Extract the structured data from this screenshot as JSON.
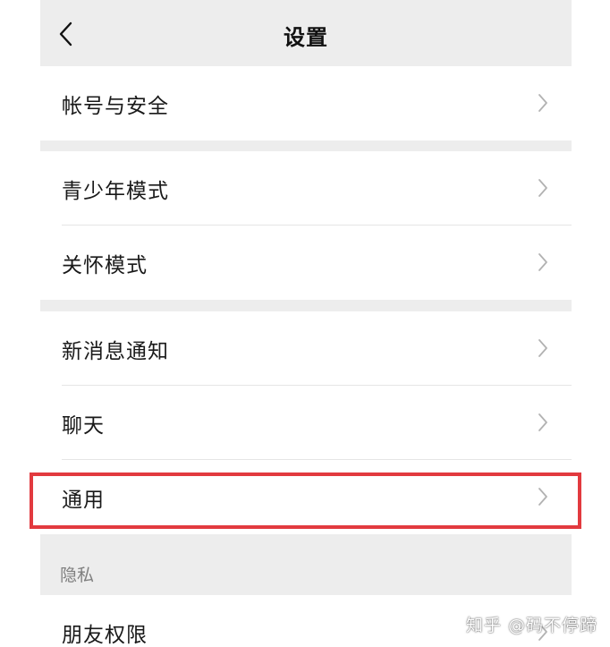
{
  "nav": {
    "title": "设置",
    "back_icon": "chevron-left-icon"
  },
  "groups": [
    {
      "items": [
        {
          "label": "帐号与安全"
        }
      ]
    },
    {
      "items": [
        {
          "label": "青少年模式"
        },
        {
          "label": "关怀模式"
        }
      ]
    },
    {
      "items": [
        {
          "label": "新消息通知"
        },
        {
          "label": "聊天"
        },
        {
          "label": "通用"
        }
      ]
    }
  ],
  "privacy": {
    "header": "隐私",
    "items": [
      {
        "label": "朋友权限"
      }
    ]
  },
  "highlight": {
    "target": "通用",
    "color": "#e23a3f"
  },
  "watermark": "知乎 @码不停蹄",
  "colors": {
    "background": "#ededed",
    "card": "#ffffff",
    "text": "#191919",
    "chevron": "#b2b2b2",
    "section_header": "#7f7f7f"
  }
}
